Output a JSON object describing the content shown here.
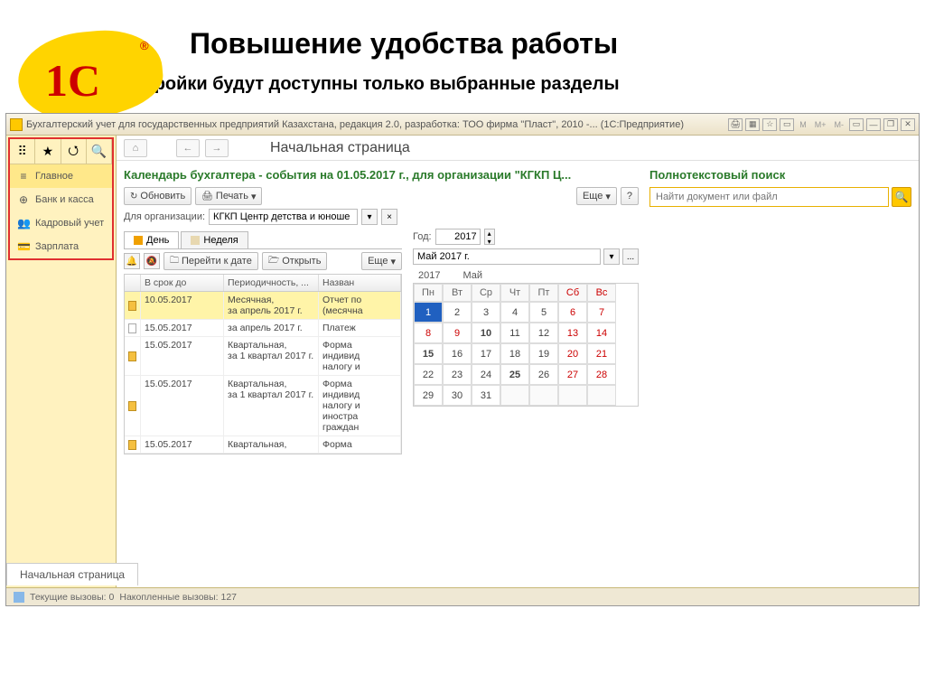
{
  "slide": {
    "title": "Повышение удобства работы",
    "subtitle": "После настройки будут доступны  только выбранные разделы"
  },
  "logo": {
    "text": "1С",
    "reg": "®"
  },
  "titlebar": {
    "text": "Бухгалтерский учет для государственных предприятий Казахстана, редакция 2.0, разработка: ТОО фирма \"Пласт\", 2010 -...  (1С:Предприятие)",
    "m_buttons": [
      "М",
      "М+",
      "М-"
    ]
  },
  "sidebar": {
    "items": [
      {
        "icon": "≡",
        "label": "Главное"
      },
      {
        "icon": "⊕",
        "label": "Банк и касса"
      },
      {
        "icon": "👥",
        "label": "Кадровый учет"
      },
      {
        "icon": "💳",
        "label": "Зарплата"
      }
    ]
  },
  "main": {
    "page_title": "Начальная страница",
    "calendar_title": "Календарь бухгалтера - события на 01.05.2017 г., для организации \"КГКП Ц...",
    "search_title": "Полнотекстовый поиск",
    "search_placeholder": "Найти документ или файл",
    "refresh": "Обновить",
    "print": "Печать",
    "more": "Еще",
    "help": "?",
    "org_label": "Для организации:",
    "org_value": "КГКП Центр детства и юноше",
    "tabs": {
      "day": "День",
      "week": "Неделя"
    },
    "goto_date": "Перейти к дате",
    "open": "Открыть",
    "year_label": "Год:",
    "year_value": "2017",
    "month_value": "Май 2017 г.",
    "cal_year": "2017",
    "cal_month": "Май",
    "table": {
      "columns": [
        "",
        "В срок до",
        "Периодичность, ...",
        "Назван"
      ],
      "rows": [
        {
          "icon": "y",
          "date": "10.05.2017",
          "period": "Месячная,\nза апрель 2017 г.",
          "name": "Отчет по\n(месячна",
          "sel": true
        },
        {
          "icon": "w",
          "date": "15.05.2017",
          "period": "за апрель 2017 г.",
          "name": "Платеж"
        },
        {
          "icon": "y",
          "date": "15.05.2017",
          "period": "Квартальная,\nза 1 квартал 2017 г.",
          "name": "Форма\nиндивид\nналогу и"
        },
        {
          "icon": "y",
          "date": "15.05.2017",
          "period": "Квартальная,\nза 1 квартал 2017 г.",
          "name": "Форма\nиндивид\nналогу и\nиностра\nграждан"
        },
        {
          "icon": "y",
          "date": "15.05.2017",
          "period": "Квартальная,",
          "name": "Форма"
        }
      ]
    },
    "calendar": {
      "dow": [
        "Пн",
        "Вт",
        "Ср",
        "Чт",
        "Пт",
        "Сб",
        "Вс"
      ],
      "weeks": [
        [
          {
            "d": "1",
            "sel": true
          },
          {
            "d": "2"
          },
          {
            "d": "3"
          },
          {
            "d": "4"
          },
          {
            "d": "5"
          },
          {
            "d": "6",
            "wk": true
          },
          {
            "d": "7",
            "wk": true
          }
        ],
        [
          {
            "d": "8",
            "wk": true
          },
          {
            "d": "9",
            "wk": true
          },
          {
            "d": "10",
            "b": true
          },
          {
            "d": "11"
          },
          {
            "d": "12"
          },
          {
            "d": "13",
            "wk": true
          },
          {
            "d": "14",
            "wk": true
          }
        ],
        [
          {
            "d": "15",
            "b": true
          },
          {
            "d": "16"
          },
          {
            "d": "17"
          },
          {
            "d": "18"
          },
          {
            "d": "19"
          },
          {
            "d": "20",
            "wk": true
          },
          {
            "d": "21",
            "wk": true
          }
        ],
        [
          {
            "d": "22"
          },
          {
            "d": "23"
          },
          {
            "d": "24"
          },
          {
            "d": "25",
            "b": true
          },
          {
            "d": "26"
          },
          {
            "d": "27",
            "wk": true
          },
          {
            "d": "28",
            "wk": true
          }
        ],
        [
          {
            "d": "29"
          },
          {
            "d": "30"
          },
          {
            "d": "31"
          },
          {
            "d": "",
            "e": true
          },
          {
            "d": "",
            "e": true
          },
          {
            "d": "",
            "e": true
          },
          {
            "d": "",
            "e": true
          }
        ]
      ]
    }
  },
  "bottom_tab": "Начальная страница",
  "status": {
    "current": "Текущие вызовы: 0",
    "accumulated": "Накопленные вызовы: 127"
  }
}
